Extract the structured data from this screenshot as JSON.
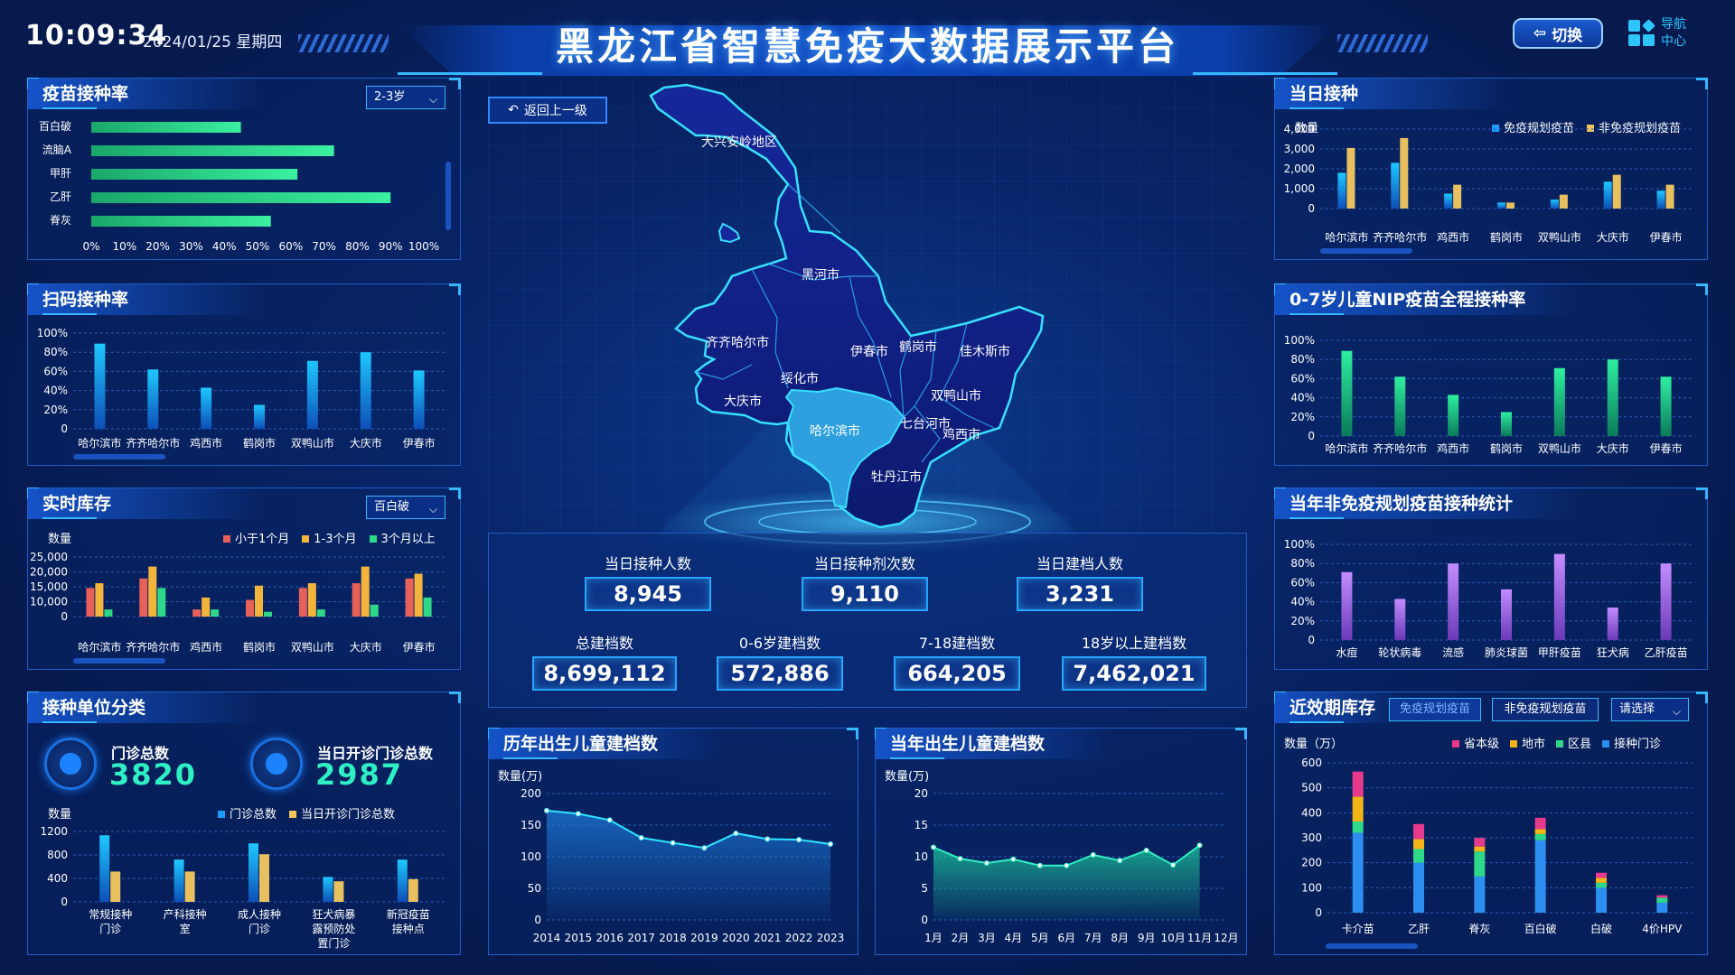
{
  "header": {
    "time": "10:09:34",
    "date": "2024/01/25 星期四",
    "title": "黑龙江省智慧免疫大数据展示平台",
    "switch_label": "切换",
    "nav_label": "导航中心"
  },
  "map": {
    "back_label": "返回上一级",
    "regions": [
      "大兴安岭地区",
      "黑河市",
      "齐齐哈尔市",
      "伊春市",
      "鹤岗市",
      "佳木斯市",
      "绥化市",
      "大庆市",
      "双鸭山市",
      "哈尔滨市",
      "七台河市",
      "鸡西市",
      "牡丹江市"
    ]
  },
  "vaccine_rate": {
    "title": "疫苗接种率",
    "dropdown": "2-3岁",
    "chart_data": {
      "type": "bar",
      "orientation": "horizontal",
      "categories": [
        "百白破",
        "流脑A",
        "甲肝",
        "乙肝",
        "脊灰"
      ],
      "values": [
        45,
        73,
        62,
        90,
        54
      ],
      "xticks": [
        "0%",
        "10%",
        "20%",
        "30%",
        "40%",
        "50%",
        "60%",
        "70%",
        "80%",
        "90%",
        "100%"
      ],
      "xlim": [
        0,
        100
      ]
    }
  },
  "scan_rate": {
    "title": "扫码接种率",
    "chart_data": {
      "type": "bar",
      "categories": [
        "哈尔滨市",
        "齐齐哈尔市",
        "鸡西市",
        "鹤岗市",
        "双鸭山市",
        "大庆市",
        "伊春市"
      ],
      "values": [
        89,
        62,
        43,
        25,
        71,
        80,
        61
      ],
      "yticks": [
        "0",
        "20%",
        "40%",
        "60%",
        "80%",
        "100%"
      ],
      "ylim": [
        0,
        100
      ]
    }
  },
  "inventory": {
    "title": "实时库存",
    "dropdown": "百白破",
    "ylabel": "数量",
    "legend": [
      "小于1个月",
      "1-3个月",
      "3个月以上"
    ],
    "colors": [
      "#e8605a",
      "#f3b43c",
      "#2ed889"
    ],
    "chart_data": {
      "type": "bar",
      "categories": [
        "哈尔滨市",
        "齐齐哈尔市",
        "鸡西市",
        "鹤岗市",
        "双鸭山市",
        "大庆市",
        "伊春市"
      ],
      "series": [
        {
          "name": "小于1个月",
          "values": [
            12000,
            16000,
            3000,
            7000,
            12000,
            14000,
            16000
          ]
        },
        {
          "name": "1-3个月",
          "values": [
            14000,
            21000,
            8000,
            13000,
            14000,
            21000,
            18000
          ]
        },
        {
          "name": "3个月以上",
          "values": [
            3000,
            12000,
            3000,
            2000,
            3000,
            5000,
            8000
          ]
        }
      ],
      "yticks": [
        "0",
        "10,000",
        "15,000",
        "20,000",
        "25,000"
      ],
      "ylim": [
        0,
        25000
      ]
    }
  },
  "units": {
    "title": "接种单位分类",
    "total_label": "门诊总数",
    "total_value": "3820",
    "open_label": "当日开诊门诊总数",
    "open_value": "2987",
    "ylabel": "数量",
    "legend": [
      "门诊总数",
      "当日开诊门诊总数"
    ],
    "chart_data": {
      "type": "bar",
      "categories": [
        "常规接种门诊",
        "产科接种室",
        "成人接种门诊",
        "狂犬病暴露预防处置门诊",
        "新冠疫苗接种点"
      ],
      "category_lines": [
        [
          "常规接种",
          "门诊"
        ],
        [
          "产科接种",
          "室"
        ],
        [
          "成人接种",
          "门诊"
        ],
        [
          "狂犬病暴",
          "露预防处",
          "置门诊"
        ],
        [
          "新冠疫苗",
          "接种点"
        ]
      ],
      "series": [
        {
          "name": "门诊总数",
          "values": [
            1230,
            780,
            1080,
            460,
            780
          ]
        },
        {
          "name": "当日开诊门诊总数",
          "values": [
            560,
            560,
            880,
            380,
            420
          ]
        }
      ],
      "yticks": [
        "0",
        "400",
        "800",
        "1200"
      ],
      "ylim": [
        0,
        1300
      ]
    }
  },
  "stats": {
    "top": [
      {
        "label": "当日接种人数",
        "value": "8,945"
      },
      {
        "label": "当日接种剂次数",
        "value": "9,110"
      },
      {
        "label": "当日建档人数",
        "value": "3,231"
      }
    ],
    "bottom": [
      {
        "label": "总建档数",
        "value": "8,699,112"
      },
      {
        "label": "0-6岁建档数",
        "value": "572,886"
      },
      {
        "label": "7-18建档数",
        "value": "664,205"
      },
      {
        "label": "18岁以上建档数",
        "value": "7,462,021"
      }
    ]
  },
  "birth_years": {
    "title": "历年出生儿童建档数",
    "ylabel": "数量(万)",
    "chart_data": {
      "type": "area",
      "x": [
        "2014",
        "2015",
        "2016",
        "2017",
        "2018",
        "2019",
        "2020",
        "2021",
        "2022",
        "2023"
      ],
      "values": [
        173,
        168,
        158,
        130,
        122,
        114,
        137,
        128,
        127,
        120
      ],
      "yticks": [
        "0",
        "50",
        "100",
        "150",
        "200"
      ],
      "ylim": [
        0,
        200
      ]
    }
  },
  "birth_months": {
    "title": "当年出生儿童建档数",
    "ylabel": "数量(万)",
    "chart_data": {
      "type": "area",
      "x": [
        "1月",
        "2月",
        "3月",
        "4月",
        "5月",
        "6月",
        "7月",
        "8月",
        "9月",
        "10月",
        "11月",
        "12月"
      ],
      "values": [
        11.5,
        9.7,
        9,
        9.6,
        8.6,
        8.6,
        10.3,
        9.4,
        11,
        8.7,
        11.8
      ],
      "yticks": [
        "0",
        "5",
        "10",
        "15",
        "20"
      ],
      "ylim": [
        0,
        20
      ]
    }
  },
  "daily": {
    "title": "当日接种",
    "ylabel": "数量",
    "legend": [
      "免疫规划疫苗",
      "非免疫规划疫苗"
    ],
    "colors": [
      "#1d9bff",
      "#f3c45c"
    ],
    "chart_data": {
      "type": "bar",
      "categories": [
        "哈尔滨市",
        "齐齐哈尔市",
        "鸡西市",
        "鹤岗市",
        "双鸭山市",
        "大庆市",
        "伊春市"
      ],
      "series": [
        {
          "name": "免疫规划疫苗",
          "values": [
            1800,
            2300,
            750,
            300,
            450,
            1350,
            900
          ]
        },
        {
          "name": "非免疫规划疫苗",
          "values": [
            3050,
            3550,
            1200,
            300,
            700,
            1700,
            1200
          ]
        }
      ],
      "yticks": [
        "0",
        "1,000",
        "2,000",
        "3,000",
        "4,000"
      ],
      "ylim": [
        0,
        4000
      ]
    }
  },
  "nip": {
    "title": "0-7岁儿童NIP疫苗全程接种率",
    "chart_data": {
      "type": "bar",
      "categories": [
        "哈尔滨市",
        "齐齐哈尔市",
        "鸡西市",
        "鹤岗市",
        "双鸭山市",
        "大庆市",
        "伊春市"
      ],
      "values": [
        89,
        62,
        43,
        25,
        71,
        80,
        62
      ],
      "yticks": [
        "0",
        "20%",
        "40%",
        "60%",
        "80%",
        "100%"
      ],
      "ylim": [
        0,
        100
      ]
    }
  },
  "non_nip": {
    "title": "当年非免疫规划疫苗接种统计",
    "chart_data": {
      "type": "bar",
      "categories": [
        "水痘",
        "轮状病毒",
        "流感",
        "肺炎球菌",
        "甲肝疫苗",
        "狂犬病",
        "乙肝疫苗"
      ],
      "values": [
        71,
        43,
        80,
        53,
        90,
        34,
        80
      ],
      "yticks": [
        "0",
        "20%",
        "40%",
        "60%",
        "80%",
        "100%"
      ],
      "ylim": [
        0,
        100
      ]
    }
  },
  "expiry": {
    "title": "近效期库存",
    "tabs": [
      "免疫规划疫苗",
      "非免疫规划疫苗"
    ],
    "dropdown": "请选择",
    "ylabel": "数量（万）",
    "legend": [
      "省本级",
      "地市",
      "区县",
      "接种门诊"
    ],
    "colors": [
      "#e83a8c",
      "#f3b418",
      "#2ed889",
      "#2b8ef0"
    ],
    "chart_data": {
      "type": "bar",
      "stacked": true,
      "categories": [
        "卡介苗",
        "乙肝",
        "脊灰",
        "百白破",
        "白破",
        "4价HPV"
      ],
      "series": [
        {
          "name": "接种门诊",
          "values": [
            320,
            200,
            145,
            290,
            100,
            40
          ]
        },
        {
          "name": "区县",
          "values": [
            45,
            55,
            100,
            25,
            20,
            20
          ]
        },
        {
          "name": "地市",
          "values": [
            100,
            40,
            20,
            20,
            20,
            0
          ]
        },
        {
          "name": "省本级",
          "values": [
            100,
            60,
            35,
            45,
            20,
            10
          ]
        }
      ],
      "yticks": [
        "0",
        "100",
        "200",
        "300",
        "400",
        "500",
        "600"
      ],
      "ylim": [
        0,
        600
      ]
    }
  }
}
